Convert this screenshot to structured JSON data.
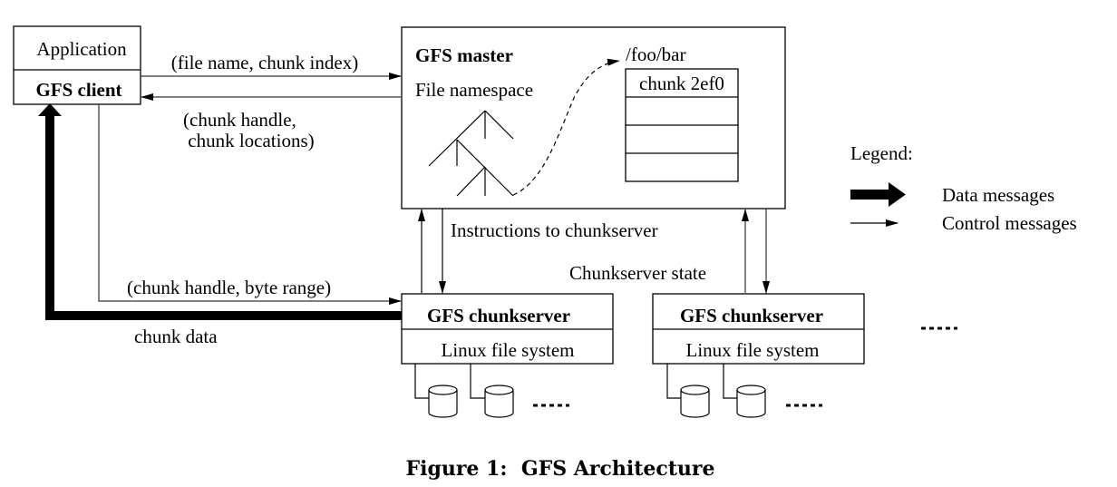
{
  "client": {
    "application_label": "Application",
    "client_label": "GFS client"
  },
  "master": {
    "title": "GFS master",
    "namespace_label": "File namespace",
    "file_path": "/foo/bar",
    "chunk_table": [
      "chunk 2ef0",
      "",
      "",
      ""
    ]
  },
  "messages": {
    "request": "(file name, chunk index)",
    "reply_line1": "(chunk handle,",
    "reply_line2": " chunk locations)",
    "instructions": "Instructions to chunkserver",
    "state": "Chunkserver state",
    "data_request": "(chunk handle, byte range)",
    "chunk_data": "chunk data"
  },
  "chunkservers": [
    {
      "title": "GFS chunkserver",
      "fs_label": "Linux file system"
    },
    {
      "title": "GFS chunkserver",
      "fs_label": "Linux file system"
    }
  ],
  "more_indicator": ".....",
  "legend": {
    "title": "Legend:",
    "data_label": "Data messages",
    "control_label": "Control messages"
  },
  "caption": "Figure 1:  GFS Architecture"
}
